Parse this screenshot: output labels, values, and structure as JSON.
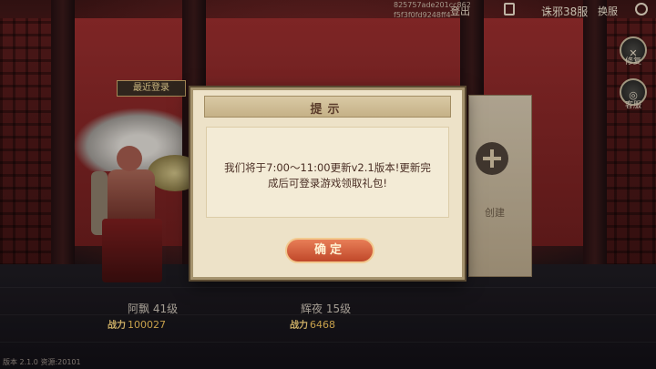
{
  "topbar": {
    "device_id_line1": "825757ade201cc862",
    "device_id_line2": "f5f3f0fd9248ff4",
    "logout_label": "登出",
    "server_label": "诛邪38服",
    "switch_label": "换服"
  },
  "side_menu": {
    "repair_label": "修复",
    "service_label": "客服"
  },
  "recent_login_label": "最近登录",
  "characters": [
    {
      "name": "阿飘",
      "level": "41级",
      "power_label": "战力",
      "power": "100027"
    },
    {
      "name": "辉夜",
      "level": "15级",
      "power_label": "战力",
      "power": "6468"
    }
  ],
  "create_label": "创建",
  "dialog": {
    "title": "提示",
    "message_line1": "我们将于7:00～11:00更新v2.1版本!更新完",
    "message_line2": "成后可登录游戏领取礼包!",
    "confirm_label": "确定"
  },
  "footer": {
    "version_text": "版本 2.1.0  资源:20101"
  }
}
